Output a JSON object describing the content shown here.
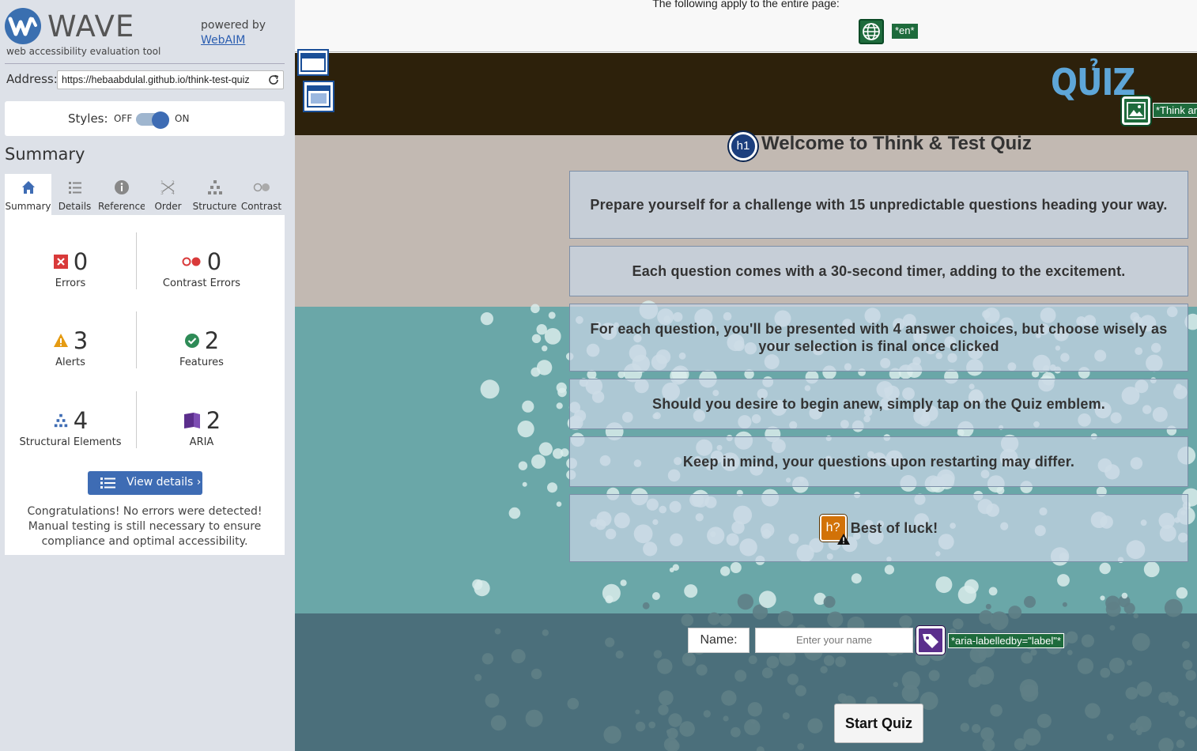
{
  "wave": {
    "brand": "WAVE",
    "tagline": "web accessibility evaluation tool",
    "powered_by": "powered by",
    "webaim_link": "WebAIM",
    "address_label": "Address:",
    "address_value": "https://hebaabdulal.github.io/think-test-quiz",
    "styles_label": "Styles:",
    "styles_off": "OFF",
    "styles_on": "ON",
    "summary_title": "Summary",
    "tabs": [
      {
        "label": "Summary",
        "icon": "home-icon"
      },
      {
        "label": "Details",
        "icon": "list-icon"
      },
      {
        "label": "Reference",
        "icon": "info-icon"
      },
      {
        "label": "Order",
        "icon": "order-icon"
      },
      {
        "label": "Structure",
        "icon": "structure-icon"
      },
      {
        "label": "Contrast",
        "icon": "contrast-icon"
      }
    ],
    "stats": {
      "errors": {
        "value": "0",
        "label": "Errors",
        "icon": "error-icon",
        "color": "#d93a3a"
      },
      "contrast_errors": {
        "value": "0",
        "label": "Contrast Errors",
        "icon": "contrast-error-icon",
        "color": "#d93a3a"
      },
      "alerts": {
        "value": "3",
        "label": "Alerts",
        "icon": "alert-icon",
        "color": "#e59b12"
      },
      "features": {
        "value": "2",
        "label": "Features",
        "icon": "feature-icon",
        "color": "#2e8b57"
      },
      "structural": {
        "value": "4",
        "label": "Structural Elements",
        "icon": "structure-icon",
        "color": "#3e6cb4"
      },
      "aria": {
        "value": "2",
        "label": "ARIA",
        "icon": "aria-icon",
        "color": "#5b2e8c"
      }
    },
    "view_details": "View details ›",
    "congrats": "Congratulations! No errors were detected! Manual testing is still necessary to ensure compliance and optimal accessibility."
  },
  "page": {
    "top_note": "The following apply to the entire page:",
    "lang_tag": "*en*",
    "alt_tag": "*Think ar",
    "heading": "Welcome to Think & Test Quiz",
    "h1_badge": "h1",
    "quiz_logo": "QUIZ",
    "quiz_logo_mark": "?",
    "instructions": [
      "Prepare yourself for a challenge with 15 unpredictable questions heading your way.",
      "Each question comes with a 30-second timer, adding to the excitement.",
      "For each question, you'll be presented with 4 answer choices, but choose wisely as your selection is final once clicked",
      "Should you desire to begin anew, simply tap on the Quiz emblem.",
      "Keep in mind, your questions upon restarting may differ."
    ],
    "best_of_luck": "Best of luck!",
    "h_alert_badge": "h?",
    "name_label": "Name:",
    "name_placeholder": "Enter your name",
    "aria_tag": "*aria-labelledby=\"label\"*",
    "start_button": "Start Quiz"
  },
  "colors": {
    "wave_blue": "#3e6cb4",
    "header_bg": "#2d210b",
    "feature_green": "#1e6b3c",
    "aria_purple": "#5b2e8c",
    "alert_orange": "#d27208"
  }
}
